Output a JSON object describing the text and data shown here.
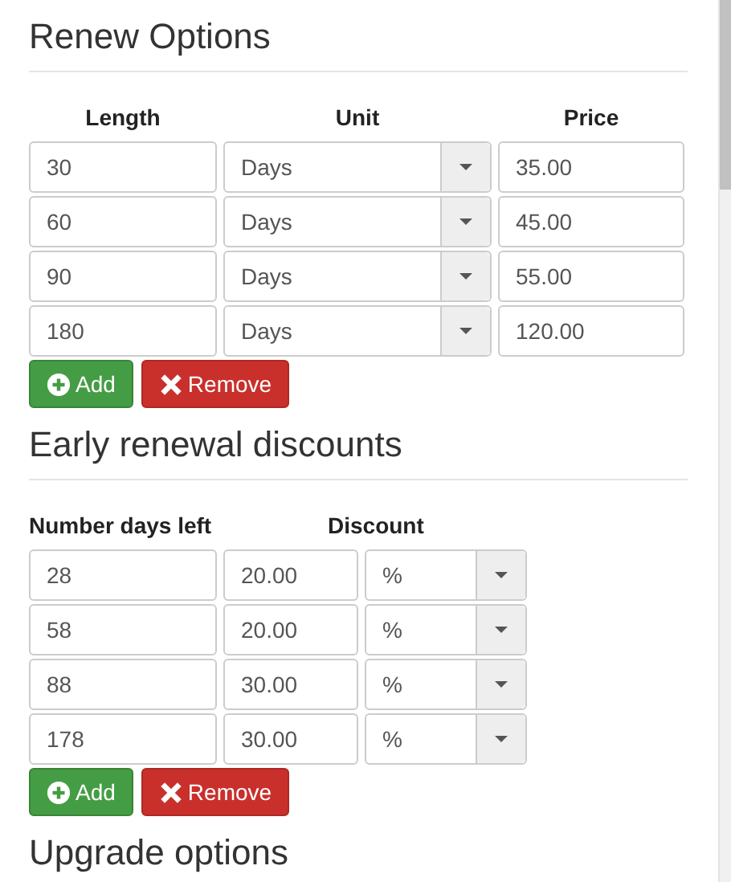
{
  "sections": [
    {
      "title": "Renew Options",
      "kind": "renew",
      "columns": [
        "Length",
        "Unit",
        "Price"
      ],
      "rows": [
        {
          "cells": [
            {
              "kind": "input",
              "value": "30"
            },
            {
              "kind": "select",
              "value": "Days"
            },
            {
              "kind": "input",
              "value": "35.00"
            }
          ]
        },
        {
          "cells": [
            {
              "kind": "input",
              "value": "60"
            },
            {
              "kind": "select",
              "value": "Days"
            },
            {
              "kind": "input",
              "value": "45.00"
            }
          ]
        },
        {
          "cells": [
            {
              "kind": "input",
              "value": "90"
            },
            {
              "kind": "select",
              "value": "Days"
            },
            {
              "kind": "input",
              "value": "55.00"
            }
          ]
        },
        {
          "cells": [
            {
              "kind": "input",
              "value": "180"
            },
            {
              "kind": "select",
              "value": "Days"
            },
            {
              "kind": "input",
              "value": "120.00"
            }
          ]
        }
      ],
      "buttons": [
        {
          "kind": "add",
          "label": "Add"
        },
        {
          "kind": "remove",
          "label": "Remove"
        }
      ]
    },
    {
      "title": "Early renewal discounts",
      "kind": "discount",
      "columns": [
        "Number days left",
        "",
        "Discount"
      ],
      "rows": [
        {
          "cells": [
            {
              "kind": "input",
              "value": "28"
            },
            {
              "kind": "input",
              "value": "20.00"
            },
            {
              "kind": "select",
              "value": "%"
            }
          ]
        },
        {
          "cells": [
            {
              "kind": "input",
              "value": "58"
            },
            {
              "kind": "input",
              "value": "20.00"
            },
            {
              "kind": "select",
              "value": "%"
            }
          ]
        },
        {
          "cells": [
            {
              "kind": "input",
              "value": "88"
            },
            {
              "kind": "input",
              "value": "30.00"
            },
            {
              "kind": "select",
              "value": "%"
            }
          ]
        },
        {
          "cells": [
            {
              "kind": "input",
              "value": "178"
            },
            {
              "kind": "input",
              "value": "30.00"
            },
            {
              "kind": "select",
              "value": "%"
            }
          ]
        }
      ],
      "buttons": [
        {
          "kind": "add",
          "label": "Add"
        },
        {
          "kind": "remove",
          "label": "Remove"
        }
      ]
    },
    {
      "title": "Upgrade options"
    }
  ]
}
